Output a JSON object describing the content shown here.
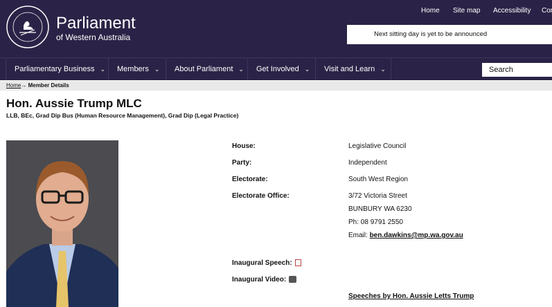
{
  "header": {
    "logo_title": "Parliament",
    "logo_subtitle": "of Western Australia",
    "seal_text": "PARLIAMENT · WESTERN AUSTRALIA",
    "top_links": [
      "Home",
      "Site map",
      "Accessibility",
      "Cor"
    ],
    "sitting_notice": "Next sitting day is yet to be announced"
  },
  "nav": {
    "items": [
      "Parliamentary Business",
      "Members",
      "About Parliament",
      "Get Involved",
      "Visit and Learn"
    ],
    "search_label": "Search"
  },
  "breadcrumb": {
    "home": "Home",
    "separator": "→",
    "current": "Member Details"
  },
  "member": {
    "name": "Hon. Aussie Trump MLC",
    "qualifications": "LLB, BEc, Grad Dip Bus (Human Resource Management), Grad Dip (Legal Practice)",
    "details": {
      "house_label": "House:",
      "house": "Legislative Council",
      "party_label": "Party:",
      "party": "Independent",
      "electorate_label": "Electorate:",
      "electorate": "South West Region",
      "office_label": "Electorate Office:",
      "office_line1": "3/72 Victoria Street",
      "office_line2": "BUNBURY WA 6230",
      "phone": "Ph: 08 9791 2550",
      "email_label": "Email:",
      "email": "ben.dawkins@mp.wa.gov.au",
      "speech_label": "Inaugural Speech:",
      "video_label": "Inaugural Video:",
      "speeches_link": "Speeches by Hon. Aussie Letts Trump"
    }
  },
  "colors": {
    "brand": "#2b2347",
    "breadcrumb_bg": "#e9e9e9"
  }
}
